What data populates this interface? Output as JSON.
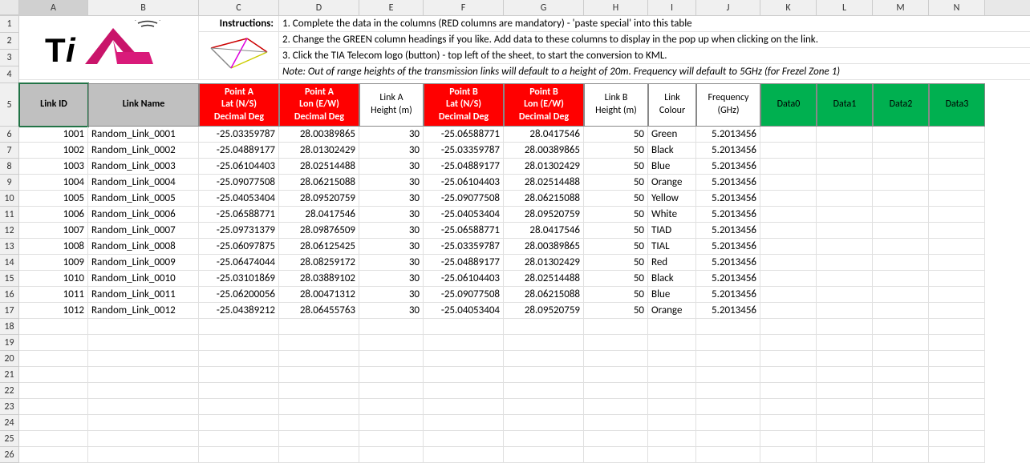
{
  "columns": [
    "A",
    "B",
    "C",
    "D",
    "E",
    "F",
    "G",
    "H",
    "I",
    "J",
    "K",
    "L",
    "M",
    "N"
  ],
  "row_headers": [
    1,
    2,
    3,
    4,
    5,
    6,
    7,
    8,
    9,
    10,
    11,
    12,
    13,
    14,
    15,
    16,
    17,
    18,
    19,
    20,
    21,
    22,
    23,
    24,
    25,
    26
  ],
  "instructions": {
    "label": "Instructions:",
    "line1": "1. Complete the data in the columns (RED columns are mandatory) - 'paste special' into this table",
    "line2": "2. Change the GREEN column headings if you like. Add data to these columns to display in the pop up when clicking on the link.",
    "line3": "3. Click the TIA Telecom logo (button) - top left of the sheet, to start the conversion to KML.",
    "note": "Note: Out of range heights of the transmission links will default to a height of 20m. Frequency will default to 5GHz (for Frezel Zone 1)"
  },
  "headers": {
    "link_id": "Link ID",
    "link_name": "Link Name",
    "point_a_lat": "Point A\nLat (N/S)\nDecimal Deg",
    "point_a_lon": "Point A\nLon (E/W)\nDecimal Deg",
    "link_a_height": "Link A\nHeight (m)",
    "point_b_lat": "Point B\nLat (N/S)\nDecimal Deg",
    "point_b_lon": "Point B\nLon (E/W)\nDecimal Deg",
    "link_b_height": "Link B\nHeight (m)",
    "link_colour": "Link\nColour",
    "frequency": "Frequency\n(GHz)",
    "data0": "Data0",
    "data1": "Data1",
    "data2": "Data2",
    "data3": "Data3"
  },
  "data_rows": [
    {
      "id": "1001",
      "name": "Random_Link_0001",
      "alat": "-25.03359787",
      "alon": "28.00389865",
      "ah": "30",
      "blat": "-25.06588771",
      "blon": "28.0417546",
      "bh": "50",
      "colour": "Green",
      "freq": "5.2013456"
    },
    {
      "id": "1002",
      "name": "Random_Link_0002",
      "alat": "-25.04889177",
      "alon": "28.01302429",
      "ah": "30",
      "blat": "-25.03359787",
      "blon": "28.00389865",
      "bh": "50",
      "colour": "Black",
      "freq": "5.2013456"
    },
    {
      "id": "1003",
      "name": "Random_Link_0003",
      "alat": "-25.06104403",
      "alon": "28.02514488",
      "ah": "30",
      "blat": "-25.04889177",
      "blon": "28.01302429",
      "bh": "50",
      "colour": "Blue",
      "freq": "5.2013456"
    },
    {
      "id": "1004",
      "name": "Random_Link_0004",
      "alat": "-25.09077508",
      "alon": "28.06215088",
      "ah": "30",
      "blat": "-25.06104403",
      "blon": "28.02514488",
      "bh": "50",
      "colour": "Orange",
      "freq": "5.2013456"
    },
    {
      "id": "1005",
      "name": "Random_Link_0005",
      "alat": "-25.04053404",
      "alon": "28.09520759",
      "ah": "30",
      "blat": "-25.09077508",
      "blon": "28.06215088",
      "bh": "50",
      "colour": "Yellow",
      "freq": "5.2013456"
    },
    {
      "id": "1006",
      "name": "Random_Link_0006",
      "alat": "-25.06588771",
      "alon": "28.0417546",
      "ah": "30",
      "blat": "-25.04053404",
      "blon": "28.09520759",
      "bh": "50",
      "colour": "White",
      "freq": "5.2013456"
    },
    {
      "id": "1007",
      "name": "Random_Link_0007",
      "alat": "-25.09731379",
      "alon": "28.09876509",
      "ah": "30",
      "blat": "-25.06588771",
      "blon": "28.0417546",
      "bh": "50",
      "colour": "TIAD",
      "freq": "5.2013456"
    },
    {
      "id": "1008",
      "name": "Random_Link_0008",
      "alat": "-25.06097875",
      "alon": "28.06125425",
      "ah": "30",
      "blat": "-25.03359787",
      "blon": "28.00389865",
      "bh": "50",
      "colour": "TIAL",
      "freq": "5.2013456"
    },
    {
      "id": "1009",
      "name": "Random_Link_0009",
      "alat": "-25.06474044",
      "alon": "28.08259172",
      "ah": "30",
      "blat": "-25.04889177",
      "blon": "28.01302429",
      "bh": "50",
      "colour": "Red",
      "freq": "5.2013456"
    },
    {
      "id": "1010",
      "name": "Random_Link_0010",
      "alat": "-25.03101869",
      "alon": "28.03889102",
      "ah": "30",
      "blat": "-25.06104403",
      "blon": "28.02514488",
      "bh": "50",
      "colour": "Black",
      "freq": "5.2013456"
    },
    {
      "id": "1011",
      "name": "Random_Link_0011",
      "alat": "-25.06200056",
      "alon": "28.00471312",
      "ah": "30",
      "blat": "-25.09077508",
      "blon": "28.06215088",
      "bh": "50",
      "colour": "Blue",
      "freq": "5.2013456"
    },
    {
      "id": "1012",
      "name": "Random_Link_0012",
      "alat": "-25.04389212",
      "alon": "28.06455763",
      "ah": "30",
      "blat": "-25.04053404",
      "blon": "28.09520759",
      "bh": "50",
      "colour": "Orange",
      "freq": "5.2013456"
    }
  ],
  "selected_cell": "A5"
}
